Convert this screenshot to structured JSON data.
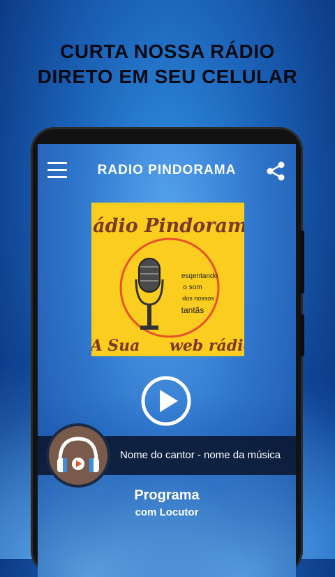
{
  "promo": {
    "line1": "CURTA NOSSA RÁDIO",
    "line2": "DIRETO EM SEU CELULAR"
  },
  "app": {
    "title": "RADIO PINDORAMA",
    "icons": {
      "menu": "menu-icon",
      "share": "share-icon",
      "play": "play-icon",
      "headphones": "headphones-icon"
    }
  },
  "logo": {
    "title": "Rádio Pindorama",
    "tagline1": "esqentando",
    "tagline2": "o som",
    "tagline3": "dos nossos",
    "tagline4": "tantãs",
    "left_bottom": "A Sua",
    "right_bottom": "web rádio"
  },
  "now_playing": {
    "track": "Nome do cantor - nome da música"
  },
  "program": {
    "name": "Programa",
    "host": "com Locutor"
  },
  "colors": {
    "logo_bg": "#fbcd1f",
    "logo_text": "#7a3a2a",
    "accent_red": "#e8502a"
  }
}
